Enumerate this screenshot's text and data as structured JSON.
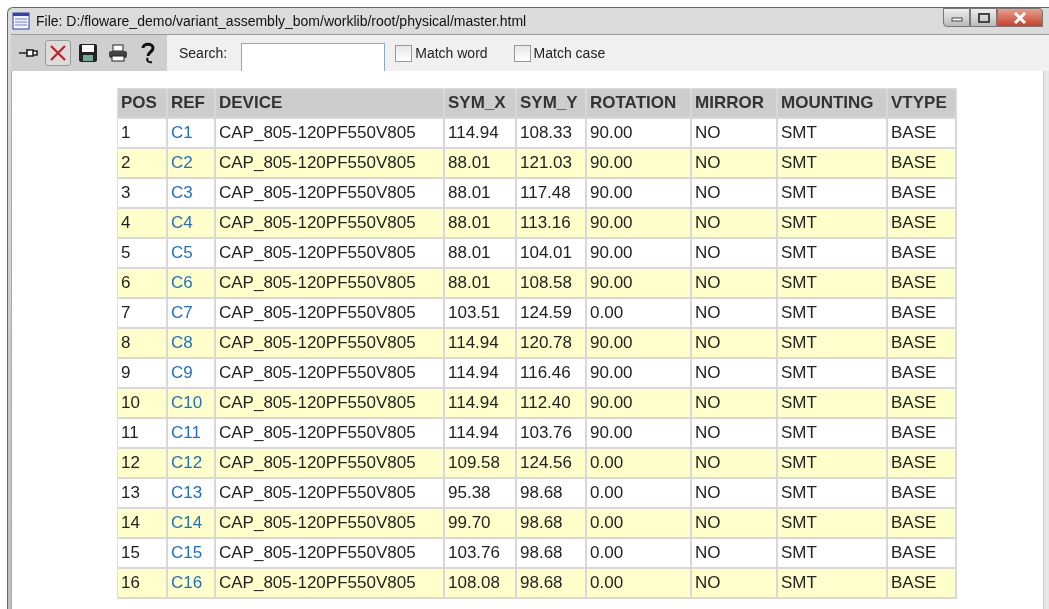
{
  "window": {
    "title": "File: D:/floware_demo/variant_assembly_bom/worklib/root/physical/master.html"
  },
  "toolbar": {
    "search_label": "Search:",
    "options": [
      {
        "label": "Match word",
        "checked": false
      },
      {
        "label": "Match case",
        "checked": false
      }
    ]
  },
  "table": {
    "columns": [
      "POS",
      "REF",
      "DEVICE",
      "SYM_X",
      "SYM_Y",
      "ROTATION",
      "MIRROR",
      "MOUNTING",
      "VTYPE"
    ],
    "rows": [
      [
        "1",
        "C1",
        "CAP_805-120PF550V805",
        "114.94",
        "108.33",
        "90.00",
        "NO",
        "SMT",
        "BASE"
      ],
      [
        "2",
        "C2",
        "CAP_805-120PF550V805",
        "88.01",
        "121.03",
        "90.00",
        "NO",
        "SMT",
        "BASE"
      ],
      [
        "3",
        "C3",
        "CAP_805-120PF550V805",
        "88.01",
        "117.48",
        "90.00",
        "NO",
        "SMT",
        "BASE"
      ],
      [
        "4",
        "C4",
        "CAP_805-120PF550V805",
        "88.01",
        "113.16",
        "90.00",
        "NO",
        "SMT",
        "BASE"
      ],
      [
        "5",
        "C5",
        "CAP_805-120PF550V805",
        "88.01",
        "104.01",
        "90.00",
        "NO",
        "SMT",
        "BASE"
      ],
      [
        "6",
        "C6",
        "CAP_805-120PF550V805",
        "88.01",
        "108.58",
        "90.00",
        "NO",
        "SMT",
        "BASE"
      ],
      [
        "7",
        "C7",
        "CAP_805-120PF550V805",
        "103.51",
        "124.59",
        "0.00",
        "NO",
        "SMT",
        "BASE"
      ],
      [
        "8",
        "C8",
        "CAP_805-120PF550V805",
        "114.94",
        "120.78",
        "90.00",
        "NO",
        "SMT",
        "BASE"
      ],
      [
        "9",
        "C9",
        "CAP_805-120PF550V805",
        "114.94",
        "116.46",
        "90.00",
        "NO",
        "SMT",
        "BASE"
      ],
      [
        "10",
        "C10",
        "CAP_805-120PF550V805",
        "114.94",
        "112.40",
        "90.00",
        "NO",
        "SMT",
        "BASE"
      ],
      [
        "11",
        "C11",
        "CAP_805-120PF550V805",
        "114.94",
        "103.76",
        "90.00",
        "NO",
        "SMT",
        "BASE"
      ],
      [
        "12",
        "C12",
        "CAP_805-120PF550V805",
        "109.58",
        "124.56",
        "0.00",
        "NO",
        "SMT",
        "BASE"
      ],
      [
        "13",
        "C13",
        "CAP_805-120PF550V805",
        "95.38",
        "98.68",
        "0.00",
        "NO",
        "SMT",
        "BASE"
      ],
      [
        "14",
        "C14",
        "CAP_805-120PF550V805",
        "99.70",
        "98.68",
        "0.00",
        "NO",
        "SMT",
        "BASE"
      ],
      [
        "15",
        "C15",
        "CAP_805-120PF550V805",
        "103.76",
        "98.68",
        "0.00",
        "NO",
        "SMT",
        "BASE"
      ],
      [
        "16",
        "C16",
        "CAP_805-120PF550V805",
        "108.08",
        "98.68",
        "0.00",
        "NO",
        "SMT",
        "BASE"
      ]
    ]
  }
}
